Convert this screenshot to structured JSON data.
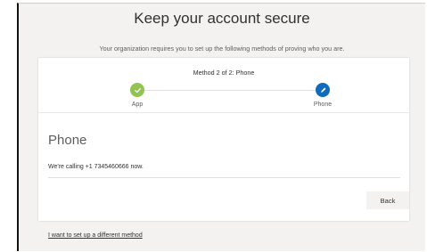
{
  "page": {
    "title": "Keep your account secure",
    "subtitle": "Your organization requires you to set up the following methods of proving who you are."
  },
  "progress": {
    "step_label": "Method 2 of 2: Phone",
    "steps": [
      {
        "label": "App",
        "state": "completed",
        "icon": "checkmark-icon",
        "color": "#92c353"
      },
      {
        "label": "Phone",
        "state": "current",
        "icon": "pencil-icon",
        "color": "#0f6cbd"
      }
    ]
  },
  "phone_section": {
    "heading": "Phone",
    "status": "We're calling +1 7345460666 now.",
    "back_label": "Back"
  },
  "footer": {
    "alt_method_link": "I want to set up a different method"
  }
}
